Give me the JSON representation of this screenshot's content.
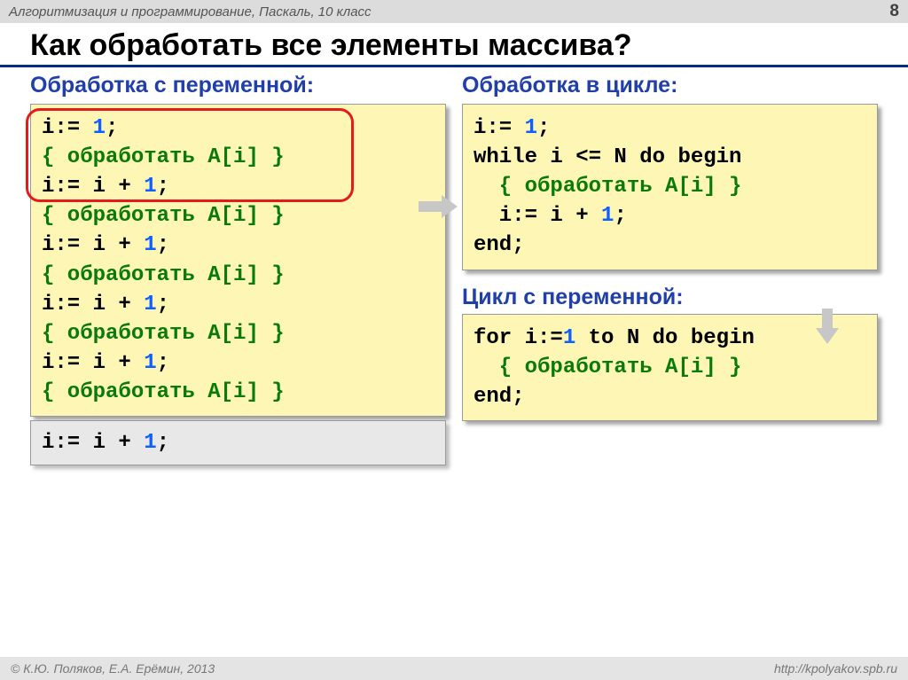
{
  "header": {
    "course": "Алгоритмизация и программирование, Паскаль, 10 класс",
    "page": "8"
  },
  "title": "Как обработать все элементы массива?",
  "left": {
    "heading": "Обработка с переменной:",
    "code": {
      "l1a": "i:= ",
      "l1b": "1",
      "l1c": ";",
      "proc": "{ обработать A[i] }",
      "inc_a": "i:= i + ",
      "inc_b": "1",
      "inc_c": ";"
    },
    "extra": {
      "inc_a": "i:= i + ",
      "inc_b": "1",
      "inc_c": ";"
    }
  },
  "right": {
    "heading": "Обработка в цикле:",
    "code": {
      "l1a": "i:= ",
      "l1b": "1",
      "l1c": ";",
      "l2": "while i <= N do begin",
      "proc": "  { обработать A[i] }",
      "inc": "  i:= i + ",
      "inc_b": "1",
      "inc_c": ";",
      "end": "end;"
    },
    "forhead": "Цикл с переменной:",
    "forcode": {
      "l1a": "for i:=",
      "l1b": "1",
      "l1c": " to N do begin",
      "proc": "  { обработать A[i] }",
      "end": "end;"
    }
  },
  "footer": {
    "left": "© К.Ю. Поляков, Е.А. Ерёмин, 2013",
    "right": "http://kpolyakov.spb.ru"
  }
}
